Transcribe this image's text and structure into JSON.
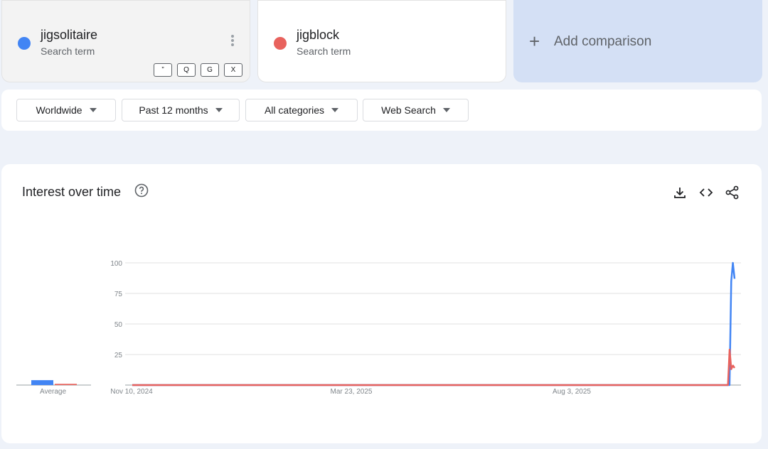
{
  "terms": [
    {
      "name": "jigsolitaire",
      "type": "Search term",
      "color": "#4285f4"
    },
    {
      "name": "jigblock",
      "type": "Search term",
      "color": "#e8625d"
    }
  ],
  "chips": [
    "”",
    "Q",
    "G",
    "X"
  ],
  "add_comparison": "Add comparison",
  "filters": {
    "region": "Worldwide",
    "period": "Past 12 months",
    "category": "All categories",
    "source": "Web Search"
  },
  "chart_title": "Interest over time",
  "icons": [
    "help-icon",
    "download-icon",
    "embed-icon",
    "share-icon",
    "more-vert-icon",
    "plus-icon",
    "caret-down-icon"
  ],
  "chart_data": {
    "type": "line",
    "title": "Interest over time",
    "ylim": [
      0,
      100
    ],
    "y_ticks": [
      25,
      50,
      75,
      100
    ],
    "x_ticks": [
      "Nov 10, 2024",
      "Mar 23, 2025",
      "Aug 3, 2025"
    ],
    "average_label": "Average",
    "averages": [
      {
        "name": "jigsolitaire",
        "value": 4,
        "color": "#4285f4"
      },
      {
        "name": "jigblock",
        "value": 1,
        "color": "#e8625d"
      }
    ],
    "series": [
      {
        "name": "jigsolitaire",
        "color": "#4285f4",
        "values": [
          0,
          0,
          0,
          0,
          0,
          0,
          0,
          0,
          0,
          0,
          0,
          0,
          0,
          0,
          0,
          0,
          0,
          0,
          0,
          0,
          0,
          0,
          0,
          0,
          0,
          0,
          0,
          0,
          0,
          0,
          0,
          0,
          0,
          0,
          0,
          0,
          0,
          0,
          0,
          0,
          0,
          0,
          0,
          0,
          0,
          0,
          0,
          0,
          0,
          0,
          0,
          0,
          0,
          0,
          0,
          0,
          0,
          0,
          0,
          0,
          0,
          0,
          0,
          0,
          0,
          0,
          0,
          0,
          0,
          0,
          0,
          0,
          0,
          0,
          0,
          0,
          0,
          0,
          0,
          0,
          0,
          0,
          0,
          0,
          0,
          0,
          0,
          0,
          0,
          0,
          0,
          0,
          0,
          0,
          0,
          0,
          0,
          0,
          0,
          0,
          0,
          0,
          0,
          0,
          0,
          0,
          0,
          0,
          0,
          0,
          0,
          0,
          0,
          0,
          0,
          0,
          0,
          0,
          0,
          0,
          0,
          0,
          0,
          0,
          0,
          0,
          0,
          0,
          0,
          0,
          0,
          0,
          0,
          0,
          0,
          0,
          0,
          0,
          0,
          0,
          0,
          0,
          0,
          0,
          0,
          0,
          0,
          0,
          0,
          0,
          0,
          0,
          0,
          0,
          0,
          0,
          0,
          0,
          0,
          0,
          0,
          0,
          0,
          0,
          0,
          0,
          0,
          0,
          0,
          0,
          0,
          0,
          0,
          0,
          0,
          0,
          0,
          0,
          0,
          0,
          0,
          0,
          0,
          0,
          0,
          0,
          0,
          0,
          0,
          0,
          0,
          0,
          0,
          0,
          0,
          0,
          0,
          0,
          0,
          0,
          0,
          0,
          0,
          0,
          0,
          0,
          0,
          0,
          0,
          0,
          0,
          0,
          0,
          0,
          0,
          0,
          0,
          0,
          0,
          0,
          0,
          0,
          0,
          0,
          0,
          0,
          0,
          0,
          0,
          0,
          0,
          0,
          0,
          0,
          0,
          0,
          0,
          0,
          0,
          0,
          0,
          0,
          0,
          0,
          0,
          0,
          0,
          0,
          0,
          0,
          0,
          0,
          0,
          0,
          0,
          0,
          0,
          0,
          0,
          0,
          0,
          0,
          0,
          0,
          0,
          0,
          0,
          0,
          0,
          0,
          0,
          0,
          0,
          0,
          0,
          0,
          0,
          0,
          0,
          0,
          0,
          0,
          0,
          0,
          0,
          0,
          0,
          0,
          0,
          0,
          0,
          0,
          0,
          0,
          0,
          0,
          0,
          0,
          0,
          0,
          0,
          0,
          0,
          0,
          0,
          0,
          0,
          0,
          0,
          0,
          0,
          0,
          0,
          0,
          0,
          0,
          0,
          0,
          0,
          0,
          0,
          0,
          0,
          0,
          0,
          0,
          0,
          0,
          0,
          0,
          0,
          0,
          0,
          0,
          0,
          0,
          0,
          0,
          0,
          0,
          0,
          0,
          0,
          0,
          0,
          0,
          0,
          0,
          0,
          0,
          0,
          0,
          0,
          0,
          0,
          0,
          0,
          0,
          85,
          100,
          87
        ]
      },
      {
        "name": "jigblock",
        "color": "#e8625d",
        "values": [
          0,
          0,
          0,
          0,
          0,
          0,
          0,
          0,
          0,
          0,
          0,
          0,
          0,
          0,
          0,
          0,
          0,
          0,
          0,
          0,
          0,
          0,
          0,
          0,
          0,
          0,
          0,
          0,
          0,
          0,
          0,
          0,
          0,
          0,
          0,
          0,
          0,
          0,
          0,
          0,
          0,
          0,
          0,
          0,
          0,
          0,
          0,
          0,
          0,
          0,
          0,
          0,
          0,
          0,
          0,
          0,
          0,
          0,
          0,
          0,
          0,
          0,
          0,
          0,
          0,
          0,
          0,
          0,
          0,
          0,
          0,
          0,
          0,
          0,
          0,
          0,
          0,
          0,
          0,
          0,
          0,
          0,
          0,
          0,
          0,
          0,
          0,
          0,
          0,
          0,
          0,
          0,
          0,
          0,
          0,
          0,
          0,
          0,
          0,
          0,
          0,
          0,
          0,
          0,
          0,
          0,
          0,
          0,
          0,
          0,
          0,
          0,
          0,
          0,
          0,
          0,
          0,
          0,
          0,
          0,
          0,
          0,
          0,
          0,
          0,
          0,
          0,
          0,
          0,
          0,
          0,
          0,
          0,
          0,
          0,
          0,
          0,
          0,
          0,
          0,
          0,
          0,
          0,
          0,
          0,
          0,
          0,
          0,
          0,
          0,
          0,
          0,
          0,
          0,
          0,
          0,
          0,
          0,
          0,
          0,
          0,
          0,
          0,
          0,
          0,
          0,
          0,
          0,
          0,
          0,
          0,
          0,
          0,
          0,
          0,
          0,
          0,
          0,
          0,
          0,
          0,
          0,
          0,
          0,
          0,
          0,
          0,
          0,
          0,
          0,
          0,
          0,
          0,
          0,
          0,
          0,
          0,
          0,
          0,
          0,
          0,
          0,
          0,
          0,
          0,
          0,
          0,
          0,
          0,
          0,
          0,
          0,
          0,
          0,
          0,
          0,
          0,
          0,
          0,
          0,
          0,
          0,
          0,
          0,
          0,
          0,
          0,
          0,
          0,
          0,
          0,
          0,
          0,
          0,
          0,
          0,
          0,
          0,
          0,
          0,
          0,
          0,
          0,
          0,
          0,
          0,
          0,
          0,
          0,
          0,
          0,
          0,
          0,
          0,
          0,
          0,
          0,
          0,
          0,
          0,
          0,
          0,
          0,
          0,
          0,
          0,
          0,
          0,
          0,
          0,
          0,
          0,
          0,
          0,
          0,
          0,
          0,
          0,
          0,
          0,
          0,
          0,
          0,
          0,
          0,
          0,
          0,
          0,
          0,
          0,
          0,
          0,
          0,
          0,
          0,
          0,
          0,
          0,
          0,
          0,
          0,
          0,
          0,
          0,
          0,
          0,
          0,
          0,
          0,
          0,
          0,
          0,
          0,
          0,
          0,
          0,
          0,
          0,
          0,
          0,
          0,
          0,
          0,
          0,
          0,
          0,
          0,
          0,
          0,
          0,
          0,
          0,
          0,
          0,
          0,
          0,
          0,
          0,
          0,
          0,
          0,
          0,
          0,
          0,
          0,
          0,
          0,
          0,
          0,
          0,
          0,
          0,
          0,
          0,
          0,
          0,
          0,
          0,
          0,
          0,
          29,
          13,
          16,
          14
        ]
      }
    ]
  }
}
